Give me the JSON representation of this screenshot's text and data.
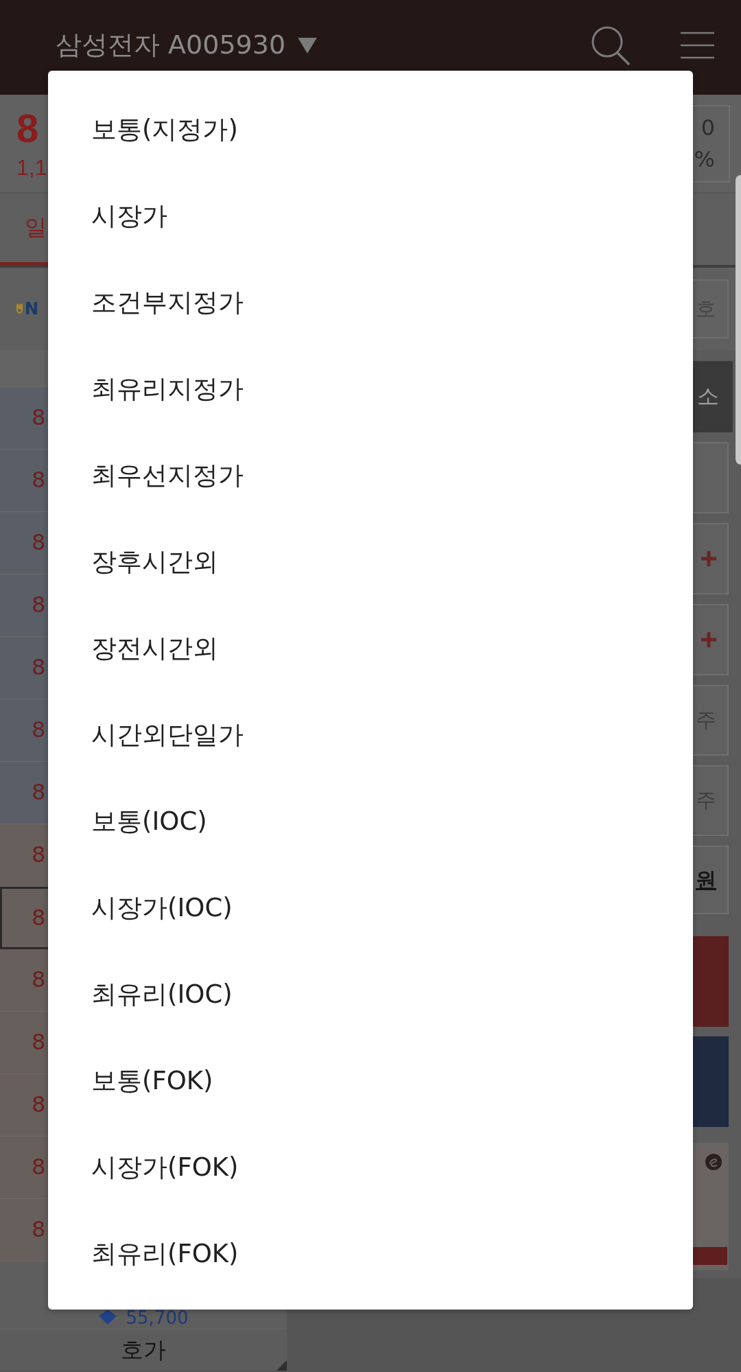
{
  "top_bar": {
    "title": "삼성전자 A005930"
  },
  "quote": {
    "price": "8",
    "change": "1,1",
    "box_lines": [
      "0",
      "%"
    ]
  },
  "tabs": [
    {
      "label": "일",
      "selected": true
    }
  ],
  "info_row": {
    "logo_text": "N",
    "button_label": "호"
  },
  "order_book": {
    "rows": [
      {
        "price": "8",
        "kind": "ask",
        "selected": false
      },
      {
        "price": "8",
        "kind": "ask",
        "selected": false
      },
      {
        "price": "8",
        "kind": "ask",
        "selected": false
      },
      {
        "price": "8",
        "kind": "ask",
        "selected": false
      },
      {
        "price": "8",
        "kind": "ask",
        "selected": false
      },
      {
        "price": "8",
        "kind": "ask",
        "selected": false
      },
      {
        "price": "8",
        "kind": "ask",
        "selected": false
      },
      {
        "price": "8",
        "kind": "bid",
        "selected": false
      },
      {
        "price": "8",
        "kind": "bid",
        "selected": true
      },
      {
        "price": "8",
        "kind": "bid",
        "selected": false
      },
      {
        "price": "8",
        "kind": "bid",
        "selected": false
      },
      {
        "price": "8",
        "kind": "bid",
        "selected": false
      },
      {
        "price": "8",
        "kind": "bid",
        "selected": false
      },
      {
        "price": "8",
        "kind": "bid",
        "selected": false
      }
    ],
    "footer_value": "55,700",
    "footer_tab": "호가"
  },
  "side_panel": [
    {
      "kind": "dark",
      "label": "소"
    },
    {
      "kind": "field"
    },
    {
      "kind": "plus"
    },
    {
      "kind": "plus"
    },
    {
      "kind": "outline",
      "label": "주"
    },
    {
      "kind": "outline",
      "label": "주"
    },
    {
      "kind": "link",
      "label": "원"
    },
    {
      "kind": "sell"
    },
    {
      "kind": "buy"
    },
    {
      "kind": "banner"
    }
  ],
  "order_type_menu": {
    "items": [
      {
        "label": "보통(지정가)",
        "selected": false
      },
      {
        "label": "시장가",
        "selected": false
      },
      {
        "label": "조건부지정가",
        "selected": false
      },
      {
        "label": "최유리지정가",
        "selected": false
      },
      {
        "label": "최우선지정가",
        "selected": false
      },
      {
        "label": "장후시간외",
        "selected": false
      },
      {
        "label": "장전시간외",
        "selected": false
      },
      {
        "label": "시간외단일가",
        "selected": false
      },
      {
        "label": "보통(IOC)",
        "selected": false
      },
      {
        "label": "시장가(IOC)",
        "selected": false
      },
      {
        "label": "최유리(IOC)",
        "selected": false
      },
      {
        "label": "보통(FOK)",
        "selected": false
      },
      {
        "label": "시장가(FOK)",
        "selected": false
      },
      {
        "label": "최유리(FOK)",
        "selected": false
      }
    ]
  }
}
